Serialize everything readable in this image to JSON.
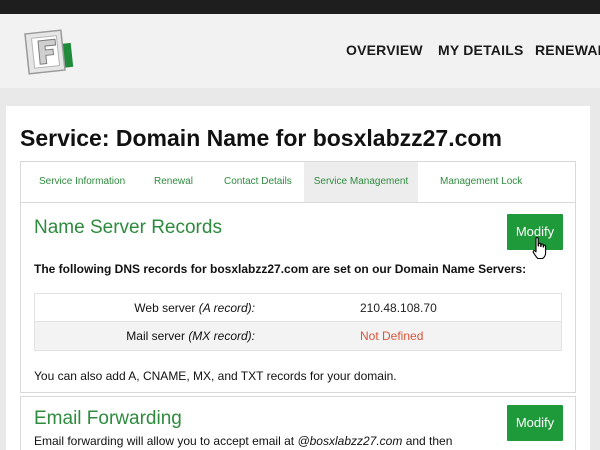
{
  "nav": {
    "overview": "OVERVIEW",
    "my_details": "MY DETAILS",
    "renewals": "RENEWALS"
  },
  "page": {
    "title": "Service: Domain Name for bosxlabzz27.com"
  },
  "tabs": [
    {
      "label": "Service Information",
      "active": false
    },
    {
      "label": "Renewal",
      "active": false
    },
    {
      "label": "Contact Details",
      "active": false
    },
    {
      "label": "Service Management",
      "active": true
    },
    {
      "label": "Management Lock",
      "active": false
    }
  ],
  "name_servers": {
    "title": "Name Server Records",
    "modify_label": "Modify",
    "description": "The following DNS records for bosxlabzz27.com are set on our Domain Name Servers:",
    "records": [
      {
        "label": "Web server",
        "type": "(A record):",
        "value": "210.48.108.70",
        "status": "ok"
      },
      {
        "label": "Mail server",
        "type": "(MX record):",
        "value": "Not Defined",
        "status": "undefined"
      }
    ],
    "note": "You can also add A, CNAME, MX, and TXT records for your domain."
  },
  "email_forwarding": {
    "title": "Email Forwarding",
    "modify_label": "Modify",
    "desc_prefix": "Email forwarding will allow you to accept email at ",
    "desc_domain": "@bosxlabzz27.com",
    "desc_suffix": " and then"
  },
  "colors": {
    "accent_green": "#1f9a3a",
    "link_green": "#2e8b3e",
    "error_red": "#d9553b",
    "topbar": "#1e1e1e"
  },
  "icons": {
    "logo": "f-logo-icon",
    "cursor": "hand-pointer-icon"
  }
}
